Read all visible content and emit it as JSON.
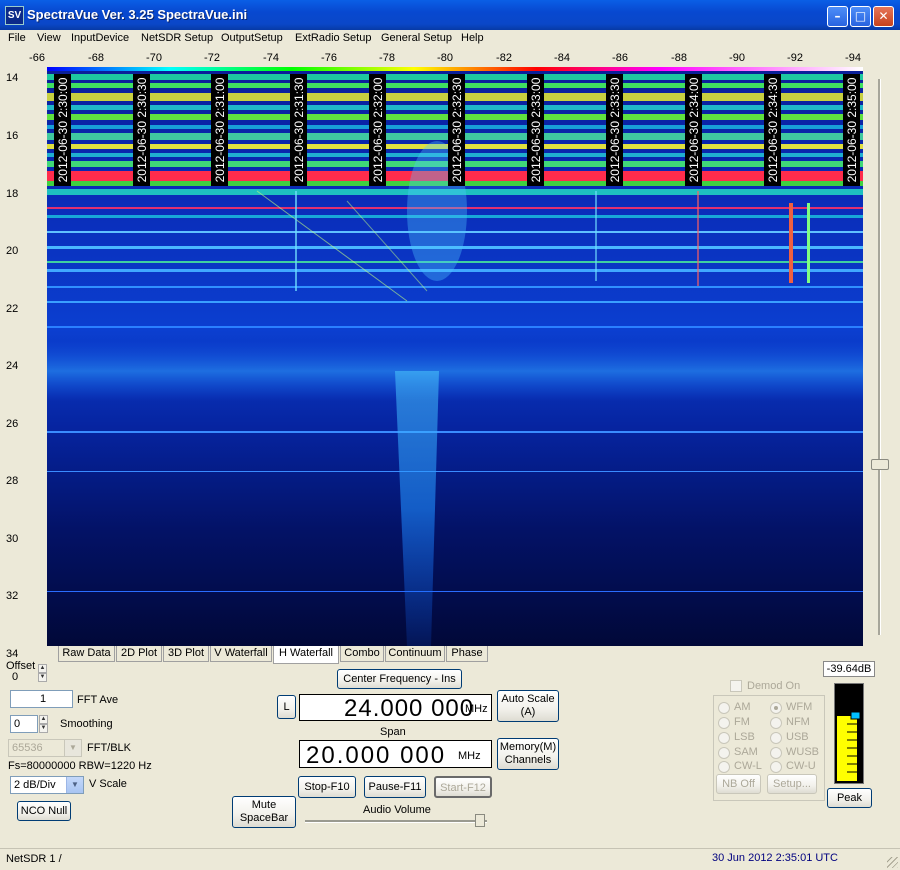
{
  "window": {
    "title": "SpectraVue Ver. 3.25  SpectraVue.ini",
    "icon_text": "SV"
  },
  "menu": [
    "File",
    "View",
    "InputDevice",
    "NetSDR Setup",
    "OutputSetup",
    "ExtRadio Setup",
    "General Setup",
    "Help"
  ],
  "x_axis_ticks": [
    "-66",
    "-68",
    "-70",
    "-72",
    "-74",
    "-76",
    "-78",
    "-80",
    "-82",
    "-84",
    "-86",
    "-88",
    "-90",
    "-92",
    "-94"
  ],
  "y_axis_ticks": [
    "14",
    "16",
    "18",
    "20",
    "22",
    "24",
    "26",
    "28",
    "30",
    "32",
    "34"
  ],
  "timestamps": [
    "2012-06-30 2:30:00",
    "2012-06-30 2:30:30",
    "2012-06-30 2:31:00",
    "2012-06-30 2:31:30",
    "2012-06-30 2:32:00",
    "2012-06-30 2:32:30",
    "2012-06-30 2:33:00",
    "2012-06-30 2:33:30",
    "2012-06-30 2:34:00",
    "2012-06-30 2:34:30",
    "2012-06-30 2:35:00"
  ],
  "tabs": [
    "Raw Data",
    "2D Plot",
    "3D Plot",
    "V Waterfall",
    "H Waterfall",
    "Combo",
    "Continuum",
    "Phase"
  ],
  "active_tab": "H Waterfall",
  "controls": {
    "offset_label": "Offset",
    "offset_value": "0",
    "fft_ave_value": "1",
    "fft_ave_label": "FFT Ave",
    "smoothing_value": "0",
    "smoothing_label": "Smoothing",
    "fft_blk_value": "65536",
    "fft_blk_label": "FFT/BLK",
    "fs_text": "Fs=80000000 RBW=1220 Hz",
    "vscale_value": "2 dB/Div",
    "vscale_label": "V Scale",
    "nco_null": "NCO Null",
    "mute": "Mute\nSpaceBar",
    "center_freq_button": "Center Frequency - Ins",
    "l_button": "L",
    "center_freq": "24.000 000",
    "freq_unit": "MHz",
    "span_label": "Span",
    "span_value": "20.000 000",
    "auto_scale": "Auto Scale\n(A)",
    "memory": "Memory(M)\nChannels",
    "stop": "Stop-F10",
    "pause": "Pause-F11",
    "start": "Start-F12",
    "audio_volume": "Audio Volume",
    "audio_volume_level": 0.95
  },
  "demod": {
    "label": "Demod On",
    "modes_left": [
      "AM",
      "FM",
      "LSB",
      "SAM",
      "CW-L"
    ],
    "modes_right": [
      "WFM",
      "NFM",
      "USB",
      "WUSB",
      "CW-U"
    ],
    "selected": "WFM",
    "nb_off": "NB Off",
    "setup": "Setup..."
  },
  "meter": {
    "reading": "-39.64dB",
    "peak": "Peak",
    "colors": {
      "bar": "#ffff00",
      "marker": "#00bfff"
    }
  },
  "status": {
    "left": "NetSDR 1  /",
    "right": "30 Jun 2012  2:35:01 UTC"
  },
  "colors": {
    "plot_bg": "#00003a",
    "title_blue": "#0a50dc",
    "status_blue": "#00007f"
  }
}
